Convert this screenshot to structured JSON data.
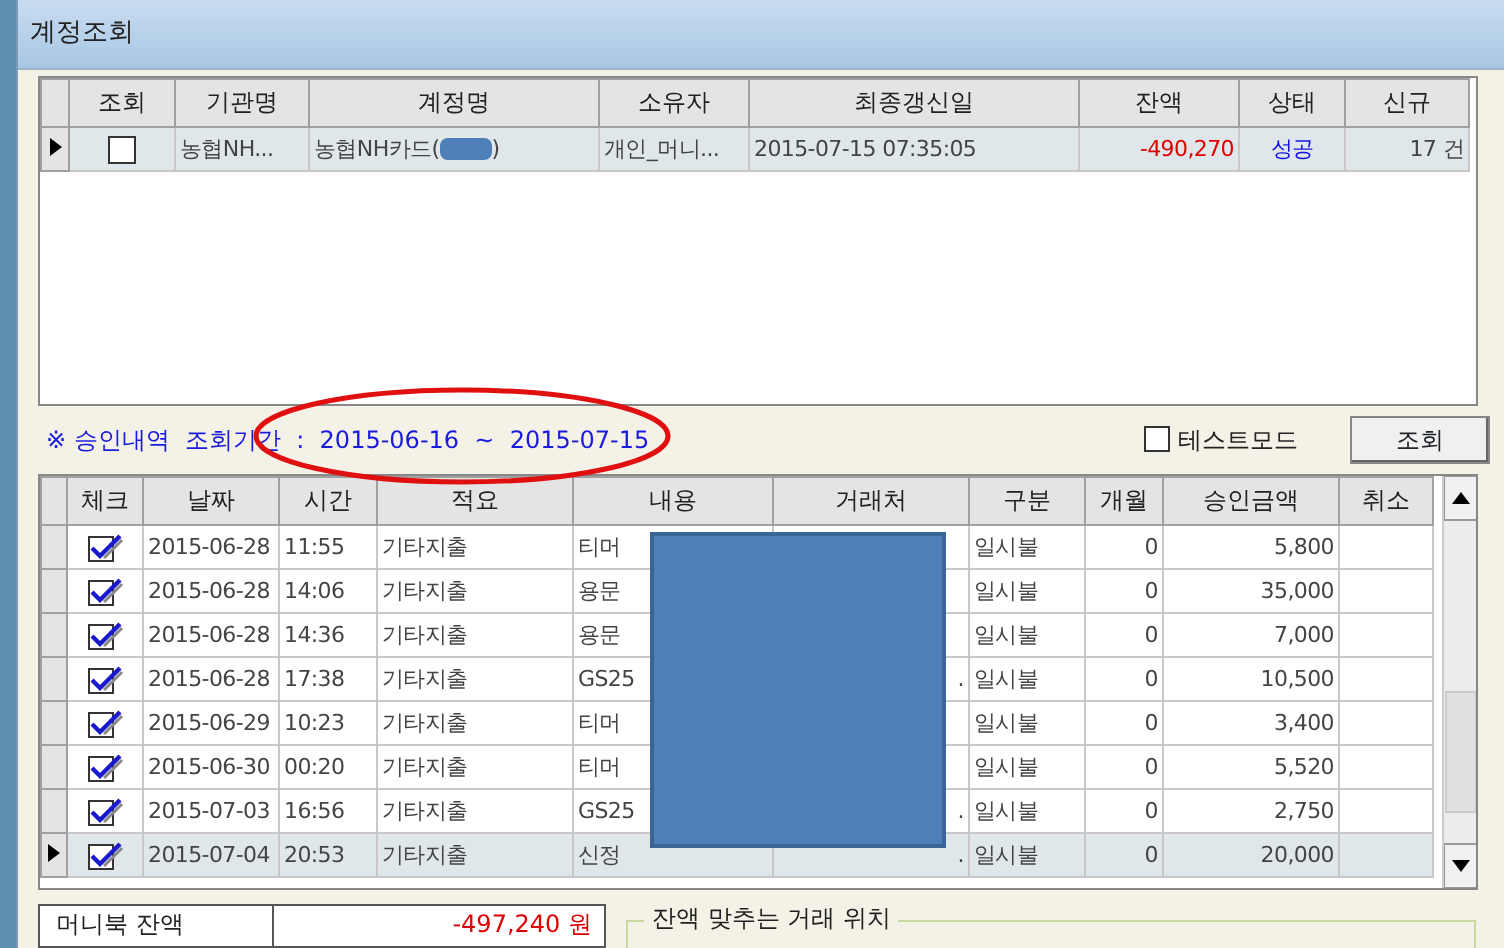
{
  "window": {
    "title": "계정조회"
  },
  "accounts": {
    "columns": [
      "조회",
      "기관명",
      "계정명",
      "소유자",
      "최종갱신일",
      "잔액",
      "상태",
      "신규"
    ],
    "rows": [
      {
        "current": true,
        "checked": false,
        "institution": "농협NH...",
        "account_name": "농협NH카드(",
        "account_name_end": ")",
        "owner": "개인_머니...",
        "updated": "2015-07-15 07:35:05",
        "balance": "-490,270",
        "status": "성공",
        "new_count": "17 건"
      }
    ]
  },
  "period": {
    "text": "※ 승인내역  조회기간  :  2015-06-16  ~  2015-07-15"
  },
  "test_mode": {
    "label": "테스트모드",
    "checked": false
  },
  "query_button": "조회",
  "approvals": {
    "columns": [
      "체크",
      "날짜",
      "시간",
      "적요",
      "내용",
      "거래처",
      "구분",
      "개월",
      "승인금액",
      "취소"
    ],
    "rows": [
      {
        "current": false,
        "checked": true,
        "date": "2015-06-28",
        "time": "11:55",
        "summary": "기타지출",
        "content": "티머",
        "merchant": "",
        "type": "일시불",
        "months": "0",
        "amount": "5,800"
      },
      {
        "current": false,
        "checked": true,
        "date": "2015-06-28",
        "time": "14:06",
        "summary": "기타지출",
        "content": "용문",
        "merchant": "",
        "type": "일시불",
        "months": "0",
        "amount": "35,000"
      },
      {
        "current": false,
        "checked": true,
        "date": "2015-06-28",
        "time": "14:36",
        "summary": "기타지출",
        "content": "용문",
        "merchant": "",
        "type": "일시불",
        "months": "0",
        "amount": "7,000"
      },
      {
        "current": false,
        "checked": true,
        "date": "2015-06-28",
        "time": "17:38",
        "summary": "기타지출",
        "content": "GS25",
        "merchant": ".",
        "type": "일시불",
        "months": "0",
        "amount": "10,500"
      },
      {
        "current": false,
        "checked": true,
        "date": "2015-06-29",
        "time": "10:23",
        "summary": "기타지출",
        "content": "티머",
        "merchant": "",
        "type": "일시불",
        "months": "0",
        "amount": "3,400"
      },
      {
        "current": false,
        "checked": true,
        "date": "2015-06-30",
        "time": "00:20",
        "summary": "기타지출",
        "content": "티머",
        "merchant": "",
        "type": "일시불",
        "months": "0",
        "amount": "5,520"
      },
      {
        "current": false,
        "checked": true,
        "date": "2015-07-03",
        "time": "16:56",
        "summary": "기타지출",
        "content": "GS25",
        "merchant": ".",
        "type": "일시불",
        "months": "0",
        "amount": "2,750"
      },
      {
        "current": true,
        "checked": true,
        "date": "2015-07-04",
        "time": "20:53",
        "summary": "기타지출",
        "content": "신정",
        "merchant": ".",
        "type": "일시불",
        "months": "0",
        "amount": "20,000"
      }
    ]
  },
  "moneybook": {
    "label": "머니북 잔액",
    "value": "-497,240 원"
  },
  "match_group": {
    "title": "잔액 맞추는 거래 위치"
  }
}
